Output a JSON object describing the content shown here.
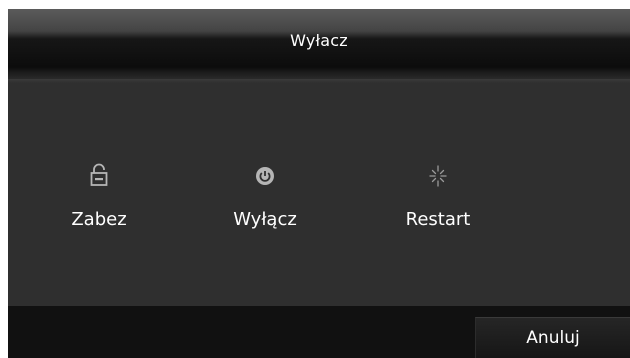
{
  "dialog": {
    "title": "Wyłacz"
  },
  "options": [
    {
      "icon": "lock-icon",
      "label": "Zabez"
    },
    {
      "icon": "power-icon",
      "label": "Wyłącz"
    },
    {
      "icon": "restart-spinner-icon",
      "label": "Restart"
    }
  ],
  "footer": {
    "cancel_label": "Anuluj"
  },
  "colors": {
    "panel": "#2f2f2f",
    "title_bar": "#0c0c0c",
    "footer": "#111111",
    "text": "#ffffff",
    "icon": "#b5b5b5"
  }
}
